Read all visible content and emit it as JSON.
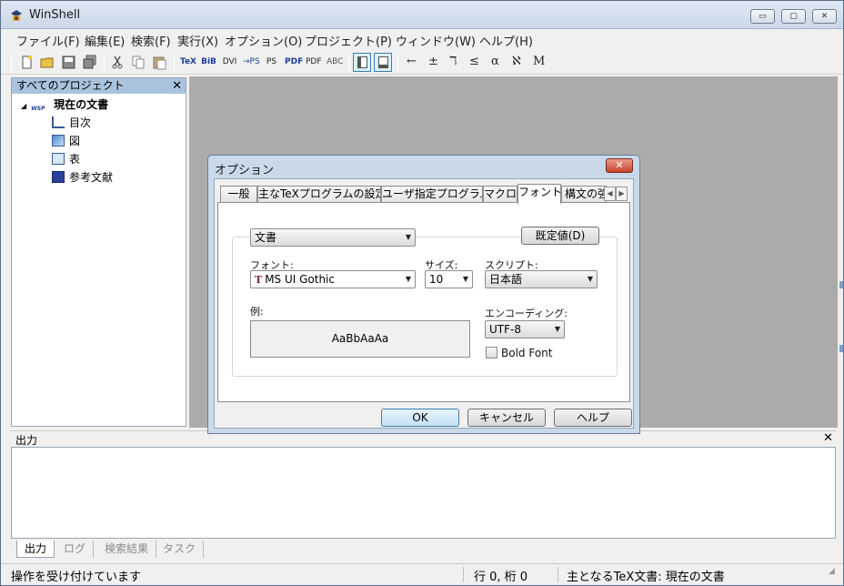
{
  "window": {
    "title": "WinShell",
    "controls": {
      "minimize": "▭",
      "maximize": "▢",
      "close": "✕"
    }
  },
  "menu": [
    "ファイル(F)",
    "編集(E)",
    "検索(F)",
    "実行(X)",
    "オプション(O)",
    "プロジェクト(P)",
    "ウィンドウ(W)",
    "ヘルプ(H)"
  ],
  "toolbar": {
    "icons": [
      "new-file",
      "open-folder",
      "save",
      "save-all",
      "cut",
      "copy",
      "paste",
      "tex",
      "bib",
      "dvi",
      "dvi-to-ps",
      "ps",
      "pdf",
      "pdf-view",
      "spell-check"
    ],
    "icon_labels": {
      "tex": "TeX",
      "bib": "BiB",
      "dvi": "DVI",
      "dvi-to-ps": "→PS",
      "ps": "PS",
      "pdf": "PDF",
      "pdf-view": "PDF",
      "spell-check": "ABC"
    },
    "symbols": [
      "←",
      "±",
      "ℸ",
      "≤",
      "α",
      "ℵ",
      "M"
    ]
  },
  "project_panel": {
    "title": "すべてのプロジェクト",
    "root": "現在の文書",
    "root_icon_text": "WSP",
    "items": [
      "目次",
      "図",
      "表",
      "参考文献"
    ]
  },
  "output_panel": {
    "title": "出力",
    "tabs": [
      "出力",
      "ログ",
      "検索結果",
      "タスク"
    ]
  },
  "statusbar": {
    "message": "操作を受け付けています",
    "position": "行 0, 桁 0",
    "main_doc": "主となるTeX文書:  現在の文書"
  },
  "dialog": {
    "title": "オプション",
    "close": "✕",
    "tabs": [
      "一般",
      "主なTeXプログラムの設定",
      "ユーザ指定プログラム",
      "マクロ",
      "フォント",
      "構文の強"
    ],
    "active_tab": "フォント",
    "target_select": "文書",
    "defaults_button": "既定値(D)",
    "font_label": "フォント:",
    "font_value": "MS UI Gothic",
    "size_label": "サイズ:",
    "size_value": "10",
    "script_label": "スクリプト:",
    "script_value": "日本語",
    "example_label": "例:",
    "example_text": "AaBbAaAa",
    "encoding_label": "エンコーディング:",
    "encoding_value": "UTF-8",
    "bold_label": "Bold Font",
    "bold_checked": false,
    "ok": "OK",
    "cancel": "キャンセル",
    "help": "ヘルプ"
  }
}
